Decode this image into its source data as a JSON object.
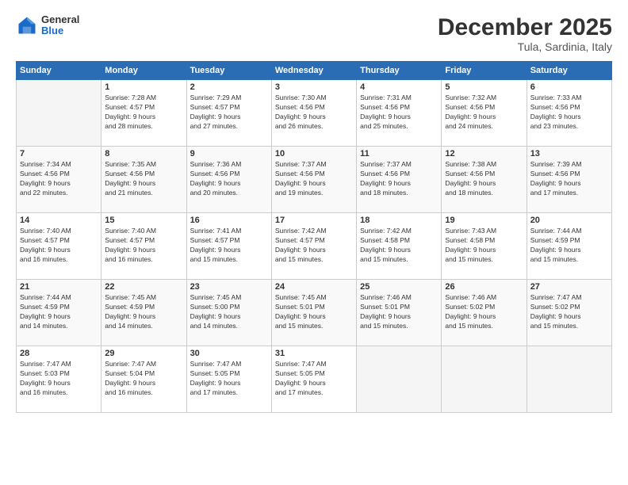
{
  "logo": {
    "general": "General",
    "blue": "Blue"
  },
  "header": {
    "month": "December 2025",
    "location": "Tula, Sardinia, Italy"
  },
  "weekdays": [
    "Sunday",
    "Monday",
    "Tuesday",
    "Wednesday",
    "Thursday",
    "Friday",
    "Saturday"
  ],
  "weeks": [
    [
      {
        "day": "",
        "info": ""
      },
      {
        "day": "1",
        "info": "Sunrise: 7:28 AM\nSunset: 4:57 PM\nDaylight: 9 hours\nand 28 minutes."
      },
      {
        "day": "2",
        "info": "Sunrise: 7:29 AM\nSunset: 4:57 PM\nDaylight: 9 hours\nand 27 minutes."
      },
      {
        "day": "3",
        "info": "Sunrise: 7:30 AM\nSunset: 4:56 PM\nDaylight: 9 hours\nand 26 minutes."
      },
      {
        "day": "4",
        "info": "Sunrise: 7:31 AM\nSunset: 4:56 PM\nDaylight: 9 hours\nand 25 minutes."
      },
      {
        "day": "5",
        "info": "Sunrise: 7:32 AM\nSunset: 4:56 PM\nDaylight: 9 hours\nand 24 minutes."
      },
      {
        "day": "6",
        "info": "Sunrise: 7:33 AM\nSunset: 4:56 PM\nDaylight: 9 hours\nand 23 minutes."
      }
    ],
    [
      {
        "day": "7",
        "info": "Sunrise: 7:34 AM\nSunset: 4:56 PM\nDaylight: 9 hours\nand 22 minutes."
      },
      {
        "day": "8",
        "info": "Sunrise: 7:35 AM\nSunset: 4:56 PM\nDaylight: 9 hours\nand 21 minutes."
      },
      {
        "day": "9",
        "info": "Sunrise: 7:36 AM\nSunset: 4:56 PM\nDaylight: 9 hours\nand 20 minutes."
      },
      {
        "day": "10",
        "info": "Sunrise: 7:37 AM\nSunset: 4:56 PM\nDaylight: 9 hours\nand 19 minutes."
      },
      {
        "day": "11",
        "info": "Sunrise: 7:37 AM\nSunset: 4:56 PM\nDaylight: 9 hours\nand 18 minutes."
      },
      {
        "day": "12",
        "info": "Sunrise: 7:38 AM\nSunset: 4:56 PM\nDaylight: 9 hours\nand 18 minutes."
      },
      {
        "day": "13",
        "info": "Sunrise: 7:39 AM\nSunset: 4:56 PM\nDaylight: 9 hours\nand 17 minutes."
      }
    ],
    [
      {
        "day": "14",
        "info": "Sunrise: 7:40 AM\nSunset: 4:57 PM\nDaylight: 9 hours\nand 16 minutes."
      },
      {
        "day": "15",
        "info": "Sunrise: 7:40 AM\nSunset: 4:57 PM\nDaylight: 9 hours\nand 16 minutes."
      },
      {
        "day": "16",
        "info": "Sunrise: 7:41 AM\nSunset: 4:57 PM\nDaylight: 9 hours\nand 15 minutes."
      },
      {
        "day": "17",
        "info": "Sunrise: 7:42 AM\nSunset: 4:57 PM\nDaylight: 9 hours\nand 15 minutes."
      },
      {
        "day": "18",
        "info": "Sunrise: 7:42 AM\nSunset: 4:58 PM\nDaylight: 9 hours\nand 15 minutes."
      },
      {
        "day": "19",
        "info": "Sunrise: 7:43 AM\nSunset: 4:58 PM\nDaylight: 9 hours\nand 15 minutes."
      },
      {
        "day": "20",
        "info": "Sunrise: 7:44 AM\nSunset: 4:59 PM\nDaylight: 9 hours\nand 15 minutes."
      }
    ],
    [
      {
        "day": "21",
        "info": "Sunrise: 7:44 AM\nSunset: 4:59 PM\nDaylight: 9 hours\nand 14 minutes."
      },
      {
        "day": "22",
        "info": "Sunrise: 7:45 AM\nSunset: 4:59 PM\nDaylight: 9 hours\nand 14 minutes."
      },
      {
        "day": "23",
        "info": "Sunrise: 7:45 AM\nSunset: 5:00 PM\nDaylight: 9 hours\nand 14 minutes."
      },
      {
        "day": "24",
        "info": "Sunrise: 7:45 AM\nSunset: 5:01 PM\nDaylight: 9 hours\nand 15 minutes."
      },
      {
        "day": "25",
        "info": "Sunrise: 7:46 AM\nSunset: 5:01 PM\nDaylight: 9 hours\nand 15 minutes."
      },
      {
        "day": "26",
        "info": "Sunrise: 7:46 AM\nSunset: 5:02 PM\nDaylight: 9 hours\nand 15 minutes."
      },
      {
        "day": "27",
        "info": "Sunrise: 7:47 AM\nSunset: 5:02 PM\nDaylight: 9 hours\nand 15 minutes."
      }
    ],
    [
      {
        "day": "28",
        "info": "Sunrise: 7:47 AM\nSunset: 5:03 PM\nDaylight: 9 hours\nand 16 minutes."
      },
      {
        "day": "29",
        "info": "Sunrise: 7:47 AM\nSunset: 5:04 PM\nDaylight: 9 hours\nand 16 minutes."
      },
      {
        "day": "30",
        "info": "Sunrise: 7:47 AM\nSunset: 5:05 PM\nDaylight: 9 hours\nand 17 minutes."
      },
      {
        "day": "31",
        "info": "Sunrise: 7:47 AM\nSunset: 5:05 PM\nDaylight: 9 hours\nand 17 minutes."
      },
      {
        "day": "",
        "info": ""
      },
      {
        "day": "",
        "info": ""
      },
      {
        "day": "",
        "info": ""
      }
    ]
  ]
}
